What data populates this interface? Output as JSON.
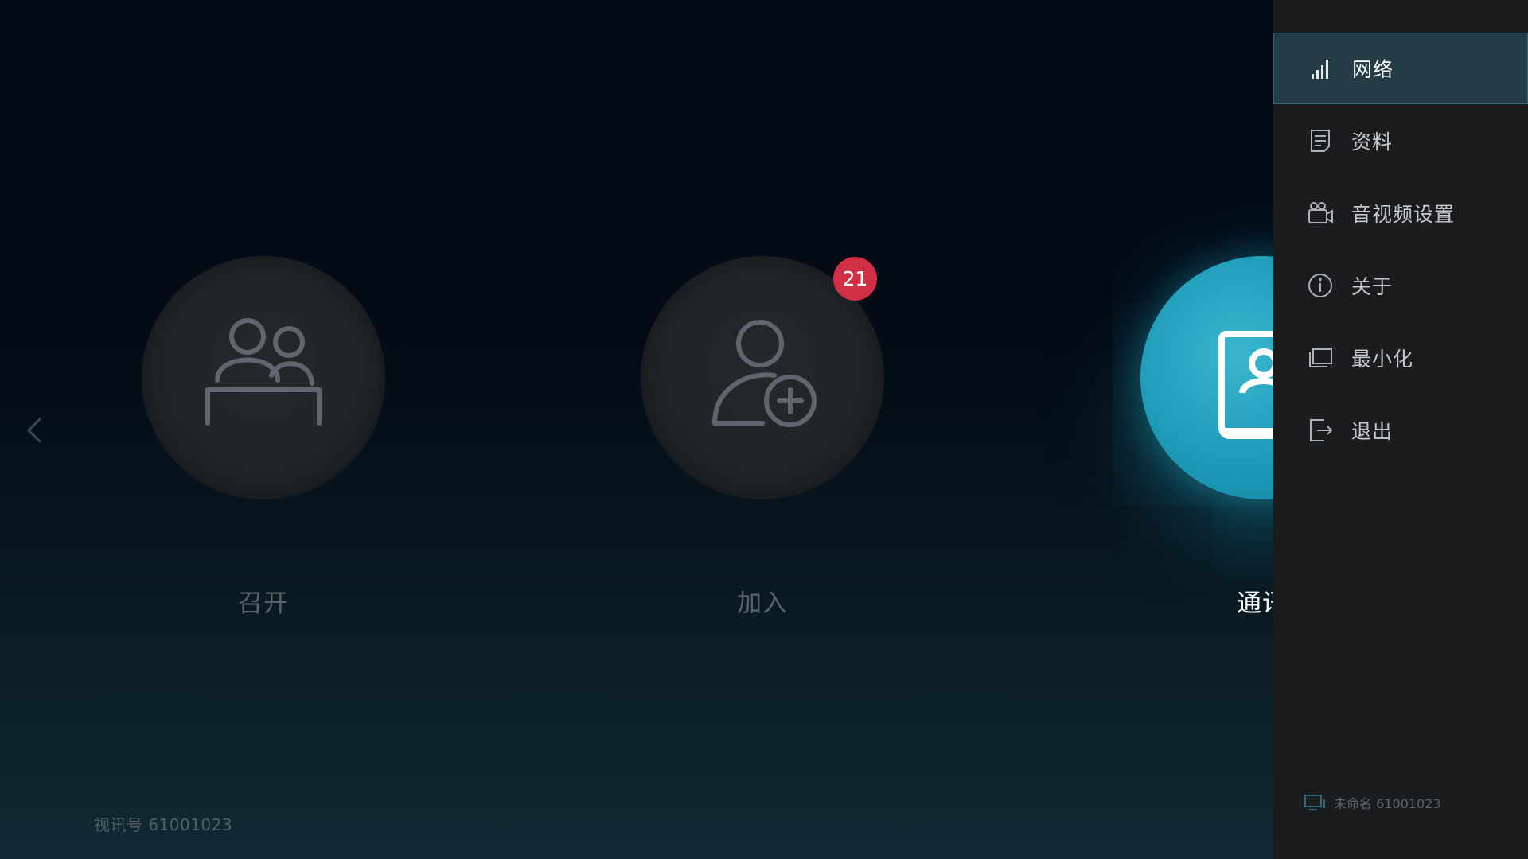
{
  "features": [
    {
      "id": "host",
      "label": "召开",
      "icon": "meeting-host-icon",
      "state": "dim"
    },
    {
      "id": "join",
      "label": "加入",
      "icon": "join-user-plus-icon",
      "state": "dim",
      "badge": "21"
    },
    {
      "id": "contacts",
      "label": "通讯",
      "icon": "address-book-icon",
      "state": "active"
    }
  ],
  "footer": {
    "meeting_id": "视讯号 61001023"
  },
  "side_menu": {
    "items": [
      {
        "label": "网络",
        "icon": "signal-bars-icon",
        "selected": true
      },
      {
        "label": "资料",
        "icon": "document-icon"
      },
      {
        "label": "音视频设置",
        "icon": "video-camera-icon"
      },
      {
        "label": "关于",
        "icon": "info-icon"
      },
      {
        "label": "最小化",
        "icon": "minimize-window-icon"
      },
      {
        "label": "退出",
        "icon": "exit-icon"
      }
    ],
    "device_text": "未命名 61001023"
  },
  "colors": {
    "accent": "#1c9ab7",
    "badge": "#d02f45",
    "panel": "#1b1c1e",
    "selected_bg": "#233c45"
  }
}
